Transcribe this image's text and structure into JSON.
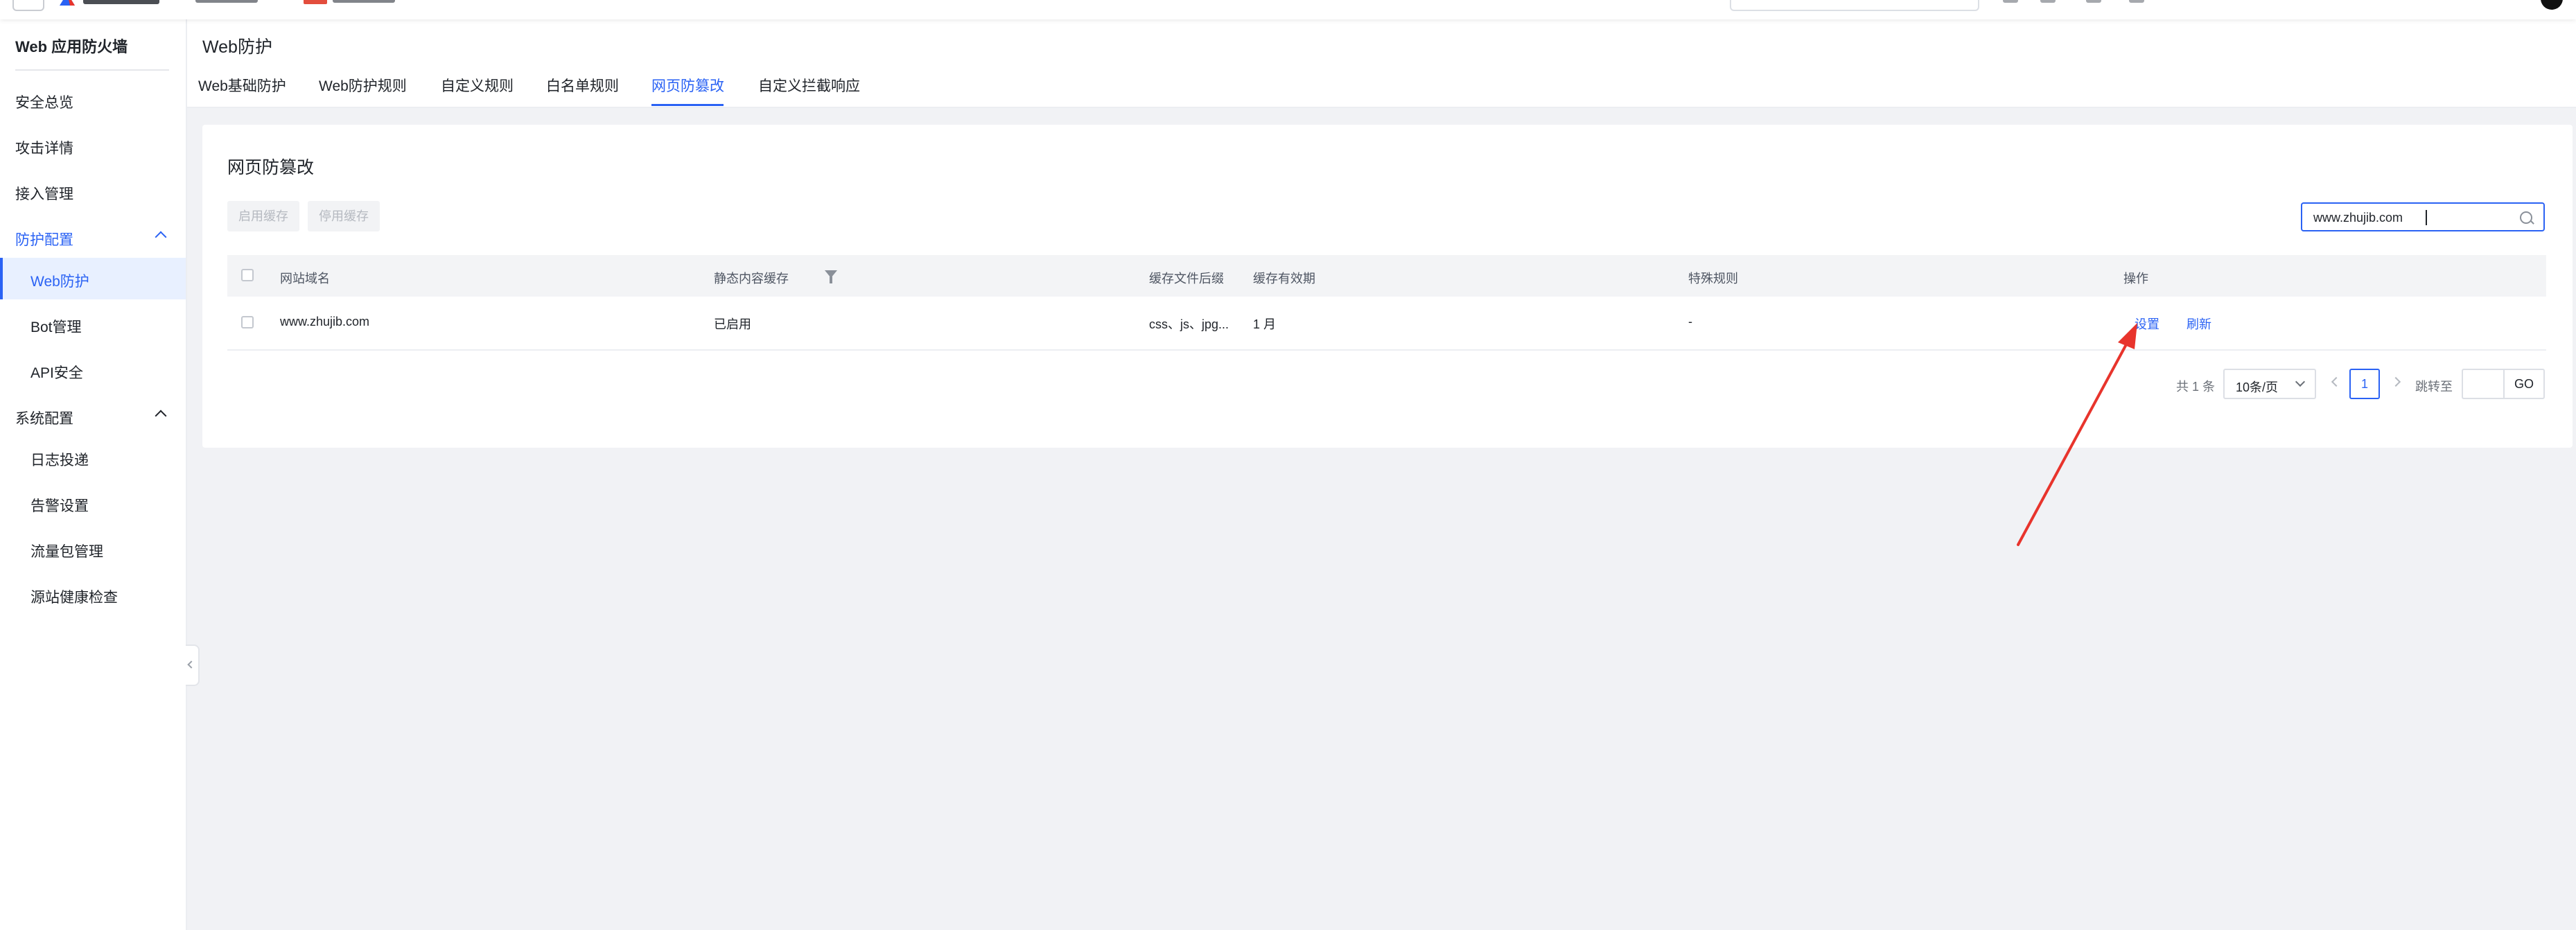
{
  "sidebar": {
    "title": "Web 应用防火墙",
    "items": [
      {
        "label": "安全总览"
      },
      {
        "label": "攻击详情"
      },
      {
        "label": "接入管理"
      },
      {
        "label": "防护配置"
      },
      {
        "label": "Web防护"
      },
      {
        "label": "Bot管理"
      },
      {
        "label": "API安全"
      },
      {
        "label": "系统配置"
      },
      {
        "label": "日志投递"
      },
      {
        "label": "告警设置"
      },
      {
        "label": "流量包管理"
      },
      {
        "label": "源站健康检查"
      }
    ]
  },
  "header": {
    "title": "Web防护",
    "tabs": [
      {
        "label": "Web基础防护"
      },
      {
        "label": "Web防护规则"
      },
      {
        "label": "自定义规则"
      },
      {
        "label": "白名单规则"
      },
      {
        "label": "网页防篡改"
      },
      {
        "label": "自定义拦截响应"
      }
    ],
    "active_tab": "网页防篡改"
  },
  "card": {
    "title": "网页防篡改",
    "enable_cache_label": "启用缓存",
    "disable_cache_label": "停用缓存",
    "search_value": "www.zhujib.com"
  },
  "table": {
    "columns": [
      "网站域名",
      "静态内容缓存",
      "缓存文件后缀",
      "缓存有效期",
      "特殊规则",
      "操作"
    ],
    "rows": [
      {
        "domain": "www.zhujib.com",
        "static_cache": "已启用",
        "suffix": "css、js、jpg...",
        "validity": "1 月",
        "special": "-",
        "action_settings": "设置",
        "action_refresh": "刷新"
      }
    ]
  },
  "pagination": {
    "total_text": "共 1 条",
    "page_size": "10条/页",
    "current_page": "1",
    "jump_label": "跳转至",
    "go_label": "GO"
  },
  "colors": {
    "accent": "#2a62f4",
    "annotation_arrow": "#e8342c"
  }
}
